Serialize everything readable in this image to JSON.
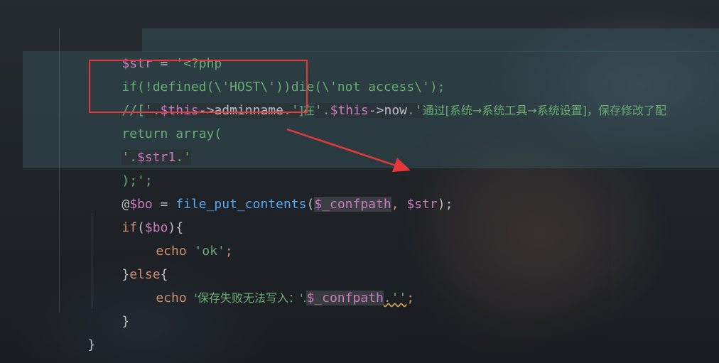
{
  "editor": {
    "lines": [
      {
        "id": "l1",
        "tokens": [
          {
            "t": "$str",
            "c": "var"
          },
          {
            "t": " = ",
            "c": "def"
          },
          {
            "t": "'<?php",
            "c": "str"
          }
        ]
      },
      {
        "id": "l2",
        "tokens": [
          {
            "t": "if(!defined(\\'HOST\\'))die(\\'not access\\');",
            "c": "str"
          }
        ]
      },
      {
        "id": "l3",
        "tokens": [
          {
            "t": "//[",
            "c": "str"
          },
          {
            "t": "'.",
            "c": "str"
          },
          {
            "t": "$this",
            "c": "var"
          },
          {
            "t": "->",
            "c": "def"
          },
          {
            "t": "adminname",
            "c": "def"
          },
          {
            "t": ".'",
            "c": "str"
          },
          {
            "t": "]在",
            "c": "str"
          },
          {
            "t": "'.",
            "c": "str"
          },
          {
            "t": "$this",
            "c": "var"
          },
          {
            "t": "->",
            "c": "def"
          },
          {
            "t": "now",
            "c": "def"
          },
          {
            "t": ".'",
            "c": "str"
          },
          {
            "t": "通过[系统→系统工具→系统设置]，保存修改了配",
            "c": "str"
          }
        ]
      },
      {
        "id": "l4",
        "tokens": [
          {
            "t": "return array(",
            "c": "str"
          }
        ]
      },
      {
        "id": "l5",
        "tokens": [
          {
            "t": "'.",
            "c": "str"
          },
          {
            "t": "$str1",
            "c": "var"
          },
          {
            "t": ".'",
            "c": "str"
          }
        ]
      },
      {
        "id": "l6",
        "tokens": [
          {
            "t": ");",
            "c": "str"
          },
          {
            "t": "';",
            "c": "str"
          }
        ]
      },
      {
        "id": "l7",
        "tokens": [
          {
            "t": "@",
            "c": "def"
          },
          {
            "t": "$bo",
            "c": "var"
          },
          {
            "t": " = ",
            "c": "def"
          },
          {
            "t": "file_put_contents",
            "c": "fn"
          },
          {
            "t": "(",
            "c": "def"
          },
          {
            "t": "$_confpath",
            "c": "var"
          },
          {
            "t": ", ",
            "c": "kw"
          },
          {
            "t": "$str",
            "c": "var"
          },
          {
            "t": ");",
            "c": "def"
          }
        ]
      },
      {
        "id": "l8",
        "tokens": [
          {
            "t": "if",
            "c": "kw"
          },
          {
            "t": "(",
            "c": "def"
          },
          {
            "t": "$bo",
            "c": "var"
          },
          {
            "t": "){",
            "c": "def"
          }
        ]
      },
      {
        "id": "l9",
        "tokens": [
          {
            "t": "echo ",
            "c": "kw"
          },
          {
            "t": "'ok'",
            "c": "str"
          },
          {
            "t": ";",
            "c": "kw"
          }
        ]
      },
      {
        "id": "l10",
        "tokens": [
          {
            "t": "}",
            "c": "def"
          },
          {
            "t": "else",
            "c": "kw"
          },
          {
            "t": "{",
            "c": "def"
          }
        ]
      },
      {
        "id": "l11",
        "tokens": [
          {
            "t": "echo ",
            "c": "kw"
          },
          {
            "t": "'保存失败无法写入：'.",
            "c": "str"
          },
          {
            "t": "$_confpath",
            "c": "var"
          },
          {
            "t": ".''",
            "c": "str"
          },
          {
            "t": ";",
            "c": "kw"
          }
        ]
      },
      {
        "id": "l12",
        "tokens": [
          {
            "t": "}",
            "c": "def"
          }
        ]
      },
      {
        "id": "l13",
        "tokens": [
          {
            "t": "}",
            "c": "def"
          }
        ]
      }
    ]
  },
  "colors": {
    "variable": "#c77dbb",
    "string": "#6aab73",
    "keyword": "#cf8e6d",
    "function": "#56a8f5",
    "default": "#bcbec4",
    "annotation": "#e5383a"
  }
}
